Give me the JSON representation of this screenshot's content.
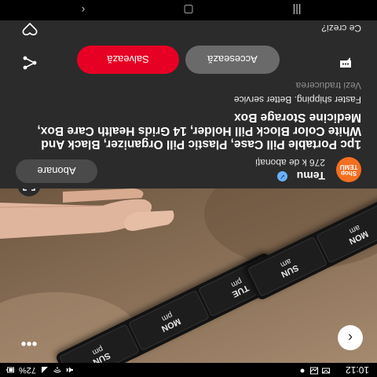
{
  "status_bar": {
    "time": "10:12",
    "battery": "72%"
  },
  "product_image": {
    "alt": "Pill organizer box held in hand",
    "pill_rows": [
      [
        {
          "day": "TUE",
          "time": "pm"
        },
        {
          "day": "MON",
          "time": "pm"
        },
        {
          "day": "SUN",
          "time": "pm"
        }
      ],
      [
        {
          "day": "MON",
          "time": "am"
        },
        {
          "day": "SUN",
          "time": "am"
        }
      ]
    ]
  },
  "publisher": {
    "logo_text": [
      "Shop",
      "TEMU"
    ],
    "name": "Temu",
    "followers": "276 k de abonați",
    "subscribe_label": "Abonare"
  },
  "product": {
    "title": "1pc Portable Pill Case, Plastic Pill Organizer, Black And White Color Block Pill Holder, 14 Grids Health Care Box, Medicine Storage Box",
    "subtitle": "Faster shipping. Better service",
    "translate_label": "Vezi traducerea"
  },
  "actions": {
    "visit_label": "Accesează",
    "save_label": "Salvează"
  },
  "feedback": {
    "label": "Ce crezi?"
  },
  "icons": {
    "back": "chevron-left-icon",
    "more": "more-dots-icon",
    "lens": "visual-search-icon",
    "share": "share-icon",
    "comment": "comment-icon",
    "heart": "heart-icon"
  },
  "colors": {
    "save": "#e60023",
    "brand": "#f36f21",
    "verified": "#6ab0ff"
  }
}
